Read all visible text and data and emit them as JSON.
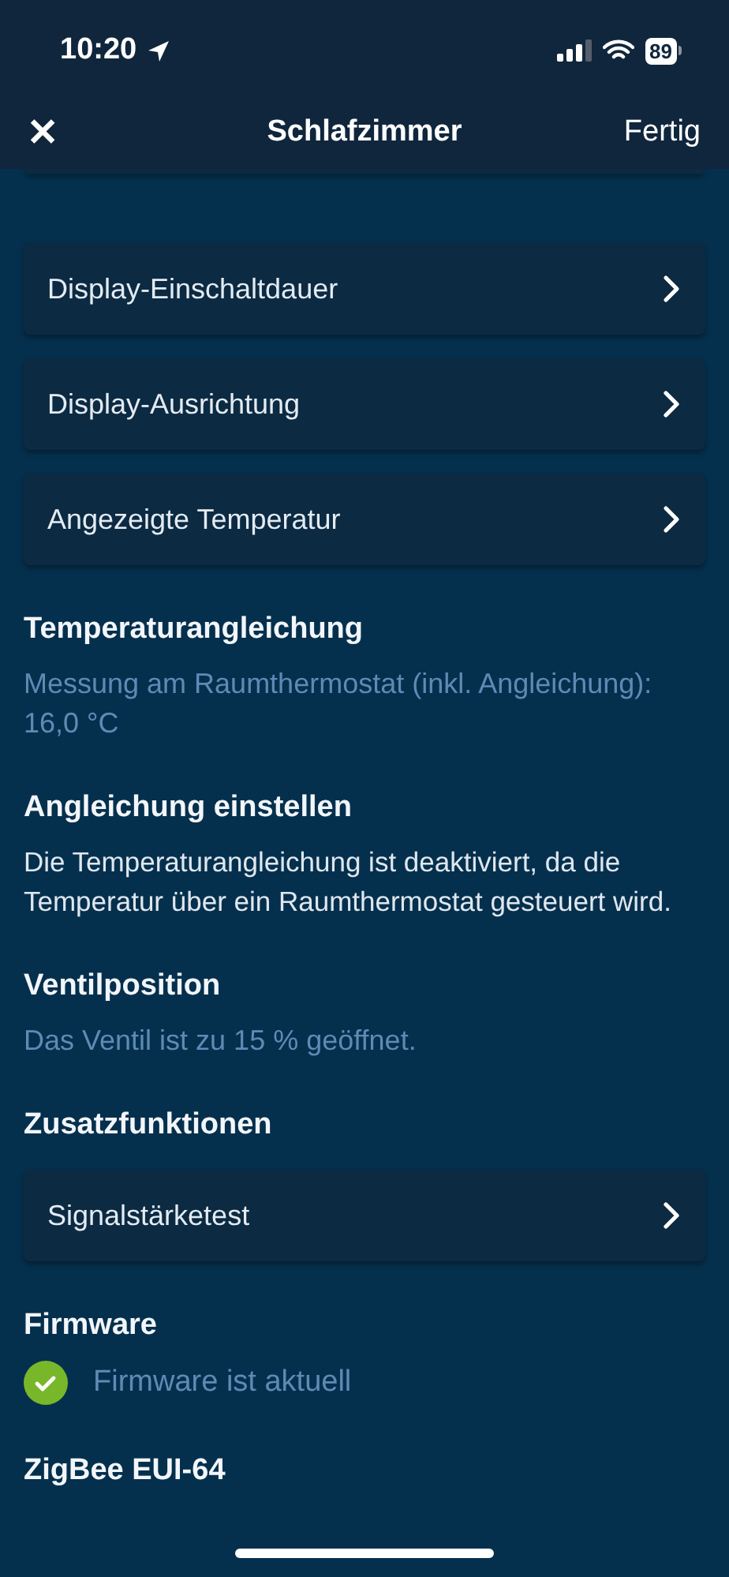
{
  "status_bar": {
    "time": "10:20",
    "battery": "89"
  },
  "header": {
    "close": "✕",
    "title": "Schlafzimmer",
    "done": "Fertig"
  },
  "blocks": [
    {
      "kind": "nav_row",
      "label": "Display-Einschaltdauer"
    },
    {
      "kind": "nav_row",
      "label": "Display-Ausrichtung"
    },
    {
      "kind": "nav_row",
      "label": "Angezeigte Temperatur"
    },
    {
      "kind": "heading",
      "text": "Temperaturangleichung"
    },
    {
      "kind": "info",
      "text": "Messung am Raumthermostat (inkl. Angleichung): 16,0 °C"
    },
    {
      "kind": "heading",
      "text": "Angleichung einstellen"
    },
    {
      "kind": "text",
      "text": "Die Temperaturangleichung ist deaktiviert, da die Temperatur über ein Raumthermostat gesteuert wird."
    },
    {
      "kind": "heading",
      "text": "Ventilposition"
    },
    {
      "kind": "info",
      "text": "Das Ventil ist zu 15 % geöffnet."
    },
    {
      "kind": "heading",
      "text": "Zusatzfunktionen"
    },
    {
      "kind": "nav_row",
      "label": "Signalstärketest"
    },
    {
      "kind": "heading",
      "text": "Firmware"
    },
    {
      "kind": "status",
      "text": "Firmware ist aktuell"
    },
    {
      "kind": "heading",
      "text": "ZigBee EUI-64"
    }
  ]
}
